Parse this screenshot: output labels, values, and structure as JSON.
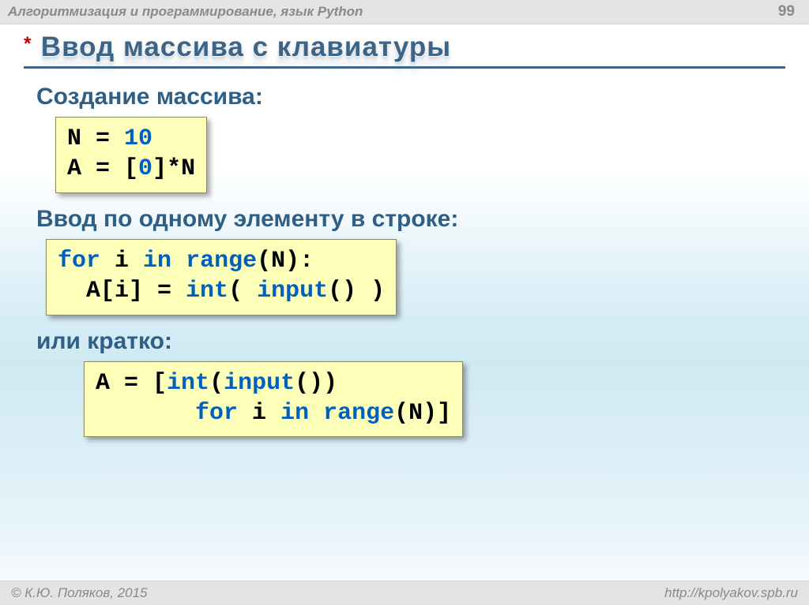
{
  "header": {
    "course": "Алгоритмизация и программирование, язык Python",
    "page_number": "99"
  },
  "title": {
    "bullet": "*",
    "text": "Ввод массива с клавиатуры"
  },
  "sections": {
    "s1_label": "Создание массива:",
    "s2_label": "Ввод по одному элементу в строке:",
    "s3_label": "или кратко:"
  },
  "code": {
    "c1": {
      "l1_a": "N",
      "l1_b": " = ",
      "l1_c": "10",
      "l2_a": "A",
      "l2_b": " = ",
      "l2_c": "[",
      "l2_d": "0",
      "l2_e": "]*N"
    },
    "c2": {
      "l1_a": "for",
      "l1_b": " i ",
      "l1_c": "in",
      "l1_d": " ",
      "l1_e": "range",
      "l1_f": "(N):",
      "l2_a": "  A[i]",
      "l2_b": " = ",
      "l2_c": "int",
      "l2_d": "( ",
      "l2_e": "input",
      "l2_f": "() )"
    },
    "c3": {
      "l1_a": "A",
      "l1_b": " = ",
      "l1_c": "[",
      "l1_d": "int",
      "l1_e": "(",
      "l1_f": "input",
      "l1_g": "())",
      "l2_a": "       ",
      "l2_b": "for",
      "l2_c": " i ",
      "l2_d": "in",
      "l2_e": " ",
      "l2_f": "range",
      "l2_g": "(N)]"
    }
  },
  "footer": {
    "copyright": "© К.Ю. Поляков, 2015",
    "url": "http://kpolyakov.spb.ru"
  }
}
